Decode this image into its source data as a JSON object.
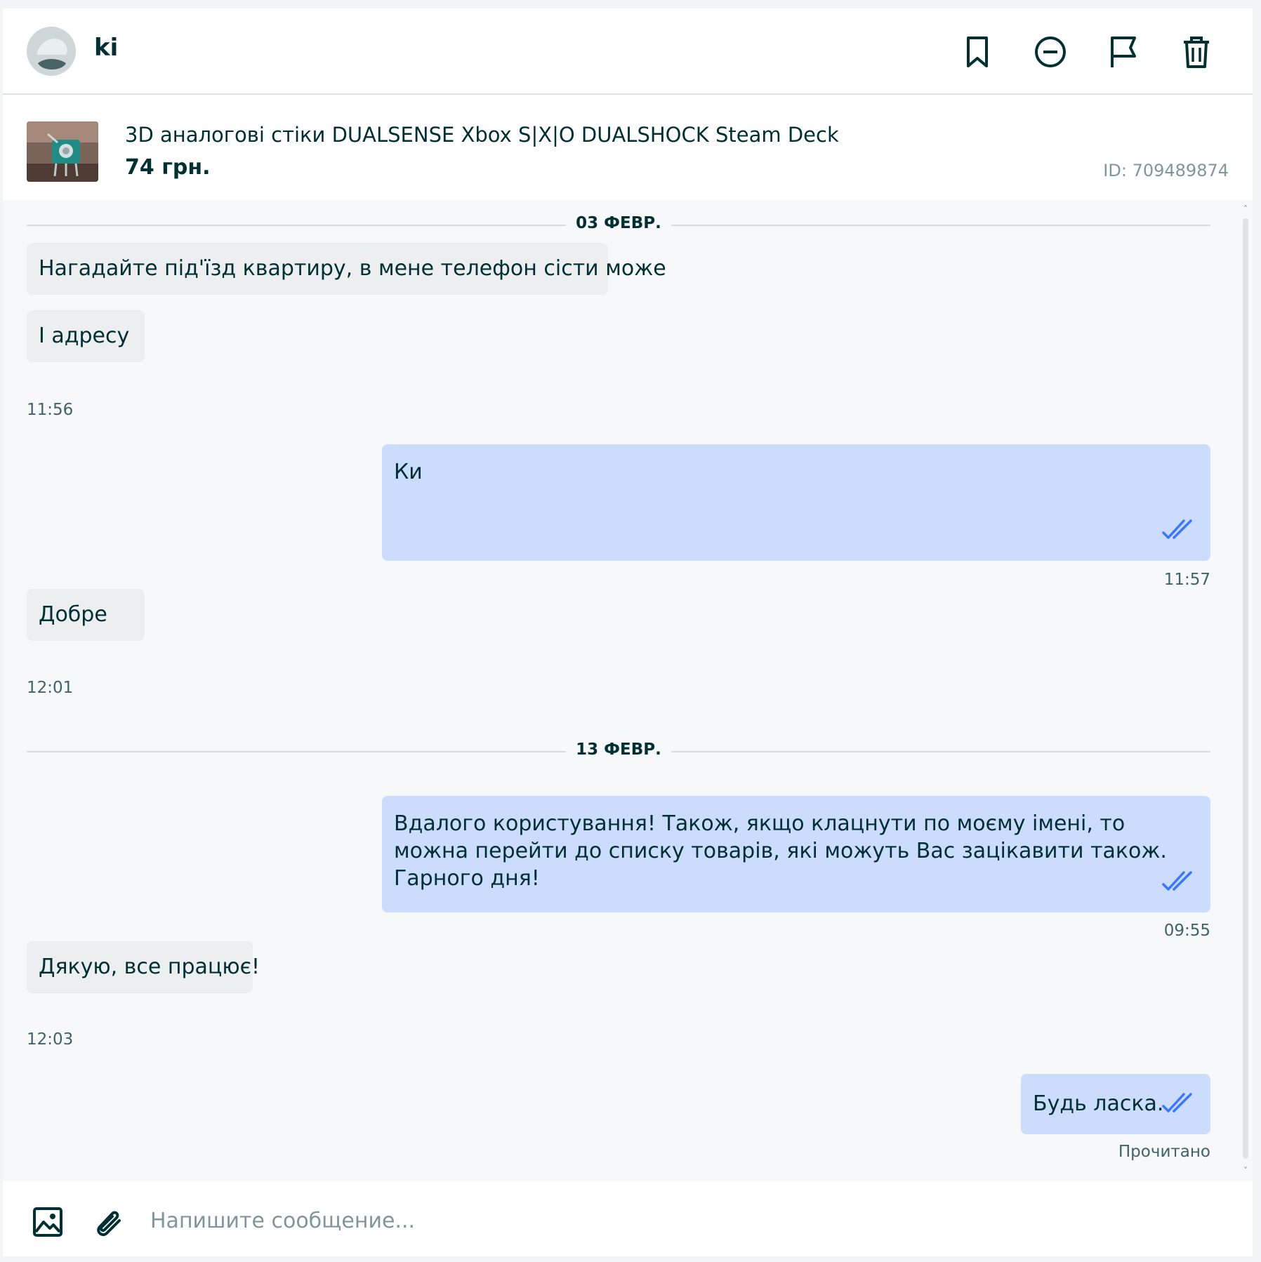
{
  "header": {
    "username": "ki",
    "icons": [
      "bookmark-icon",
      "block-icon",
      "flag-icon",
      "trash-icon"
    ]
  },
  "product": {
    "title": "3D аналогові стіки DUALSENSE Xbox S|X|O DUALSHOCK Steam Deck",
    "price": "74 грн.",
    "id": "ID: 709489874"
  },
  "dates": {
    "first": "03 ФЕВР.",
    "second": "13 ФЕВР."
  },
  "messages": [
    {
      "direction": "in",
      "text": "Нагадайте під'їзд квартиру, в мене телефон сісти може",
      "time": ""
    },
    {
      "direction": "in",
      "text": "І адресу",
      "time": "11:56"
    },
    {
      "direction": "out",
      "text": "Ки",
      "time": "11:57"
    },
    {
      "direction": "in",
      "text": "Добре",
      "time": "12:01"
    },
    {
      "direction": "out",
      "text": "Вдалого користування! Також, якщо клацнути по моєму імені, то можна перейти до списку товарів, які можуть Вас зацікавити також. Гарного дня!",
      "time": "09:55"
    },
    {
      "direction": "in",
      "text": "Дякую, все працює!",
      "time": "12:03"
    },
    {
      "direction": "out",
      "text": "Будь ласка.",
      "time": "Прочитано"
    }
  ],
  "composer": {
    "placeholder": "Напишите сообщение..."
  },
  "colors": {
    "text": "#002f34",
    "incoming_bubble": "#eceef0",
    "outgoing_bubble": "#ccdcfd",
    "read_ticks": "#3a77ff"
  }
}
